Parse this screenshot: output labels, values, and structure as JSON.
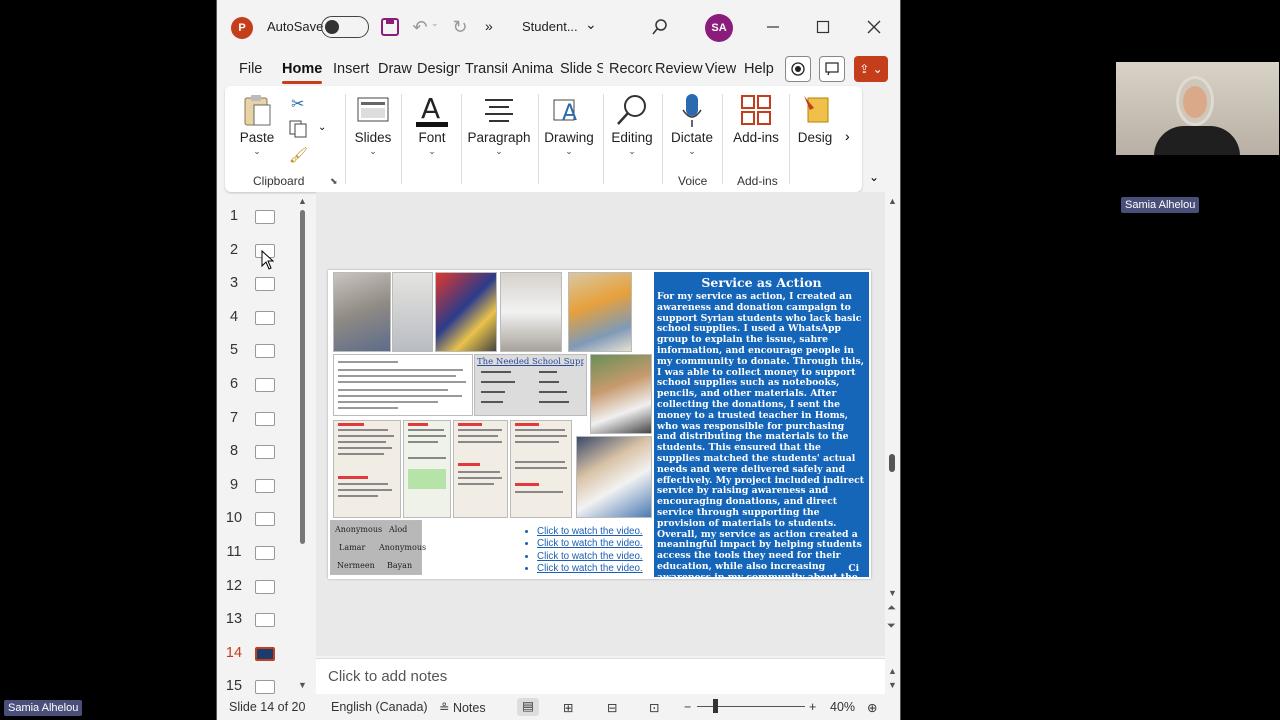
{
  "titlebar": {
    "autosave_label": "AutoSave",
    "doc_title": "Student...",
    "user_initials": "SA",
    "more": "»"
  },
  "menu": [
    "File",
    "Home",
    "Insert",
    "Draw",
    "Design",
    "Transit",
    "Anima",
    "Slide S",
    "Recorc",
    "Review",
    "View",
    "Help"
  ],
  "ribbon": {
    "paste": "Paste",
    "clipboard": "Clipboard",
    "slides": "Slides",
    "font": "Font",
    "paragraph": "Paragraph",
    "drawing": "Drawing",
    "editing": "Editing",
    "dictate": "Dictate",
    "voice": "Voice",
    "addins": "Add-ins",
    "addins_group": "Add-ins",
    "designer": "Desig",
    "more": "›"
  },
  "thumbnails": [
    "1",
    "2",
    "3",
    "4",
    "5",
    "6",
    "7",
    "8",
    "9",
    "10",
    "11",
    "12",
    "13",
    "14",
    "15"
  ],
  "active_slide": "14",
  "slide": {
    "heading": "Service as Action",
    "body": "For my service as action, I created an awareness and donation campaign to support Syrian students who lack basic school supplies. I used a WhatsApp group to explain the issue, sahre information, and encourage people in my community to donate. Through this, I was able to collect money to support school supplies such as notebooks, pencils, and other materials. After collecting the donations, I sent the money to a trusted teacher in Homs, who was responsible for purchasing and distributing the materials to the students. This ensured that the supplies matched the students' actual needs and were delivered safely and effectively. My project included indirect service by raising awareness and encouraging donations, and direct service through supporting the provision of materials to students. Overall, my service as action created a meaningful impact by helping students access the tools they need for their education, while also increasing awareness in my community about the challenges faced by Syrian students.",
    "ci": "Ci",
    "links": [
      "Click to watch the video.",
      "Click to watch the video.",
      "Click to watch the video.",
      "Click to watch the video."
    ],
    "supplies_title": "The Needed School Supplies",
    "names": [
      "Anonymous",
      "Alod",
      "Lamar",
      "Anonymous",
      "Nermeen",
      "Bayan"
    ]
  },
  "notes_placeholder": "Click to add notes",
  "status": {
    "slide_count": "Slide 14 of 20",
    "language": "English (Canada)",
    "notes": "Notes",
    "zoom": "40%"
  },
  "participant": {
    "name": "Samia Alhelou"
  },
  "colors": {
    "accent": "#c43e1c",
    "slide_blue": "#1565b8"
  }
}
